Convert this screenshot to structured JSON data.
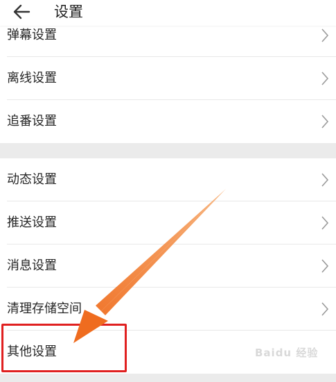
{
  "header": {
    "title": "设置",
    "back_icon": "arrow-left-icon"
  },
  "rows": [
    {
      "label": "弹幕设置"
    },
    {
      "label": "离线设置"
    },
    {
      "label": "追番设置"
    },
    {
      "label": "动态设置"
    },
    {
      "label": "推送设置"
    },
    {
      "label": "消息设置"
    },
    {
      "label": "清理存储空间"
    },
    {
      "label": "其他设置"
    }
  ],
  "annotation": {
    "highlight_color": "#e02020",
    "arrow_color": "#f07a2a",
    "target": "其他设置"
  },
  "watermark": {
    "text": "Baidu 经验"
  },
  "colors": {
    "section_gap": "#ebebeb",
    "divider": "#e8e8e8",
    "chevron": "#9a9a9a"
  }
}
